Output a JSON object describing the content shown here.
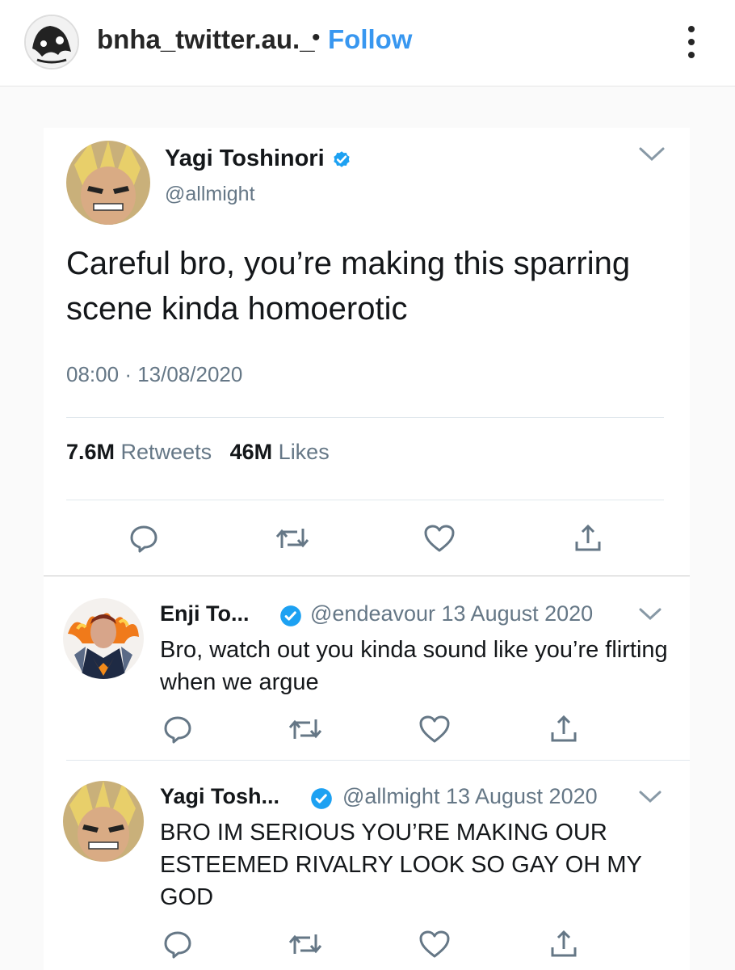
{
  "instagram": {
    "username": "bnha_twitter.au._",
    "separator": "•",
    "follow_label": "Follow",
    "more_icon": "more-vertical-icon"
  },
  "tweet": {
    "display_name": "Yagi Toshinori",
    "handle": "@allmight",
    "text": "Careful bro, you’re making this sparring scene kinda homoerotic",
    "time": "08:00",
    "sep": "·",
    "date": "13/08/2020",
    "retweets_count": "7.6M",
    "retweets_label": "Retweets",
    "likes_count": "46M",
    "likes_label": "Likes"
  },
  "replies": [
    {
      "display_name": "Enji To...",
      "meta": "@endeavour 13 August 2020",
      "text": "Bro, watch out you kinda sound like you’re flirting when we argue"
    },
    {
      "display_name": "Yagi Tosh...",
      "meta": "@allmight 13 August 2020",
      "text": "BRO IM SERIOUS YOU’RE MAKING OUR ESTEEMED RIVALRY LOOK SO GAY OH MY GOD"
    }
  ],
  "colors": {
    "twitter_blue": "#1da1f2",
    "verified_blue": "#1da1f2",
    "muted": "#657786",
    "icon": "#657786",
    "instagram_blue": "#3897f0"
  }
}
